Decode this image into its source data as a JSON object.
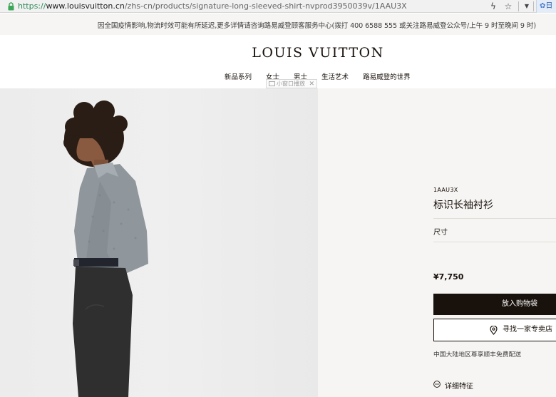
{
  "browser": {
    "url_scheme": "https://",
    "url_host": "www.louisvuitton.cn",
    "url_path": "/zhs-cn/products/signature-long-sleeved-shirt-nvprod3950039v/1AAU3X",
    "ext_tab_label": "日"
  },
  "notice": {
    "text": "因全国疫情影响,物流时效可能有所延迟,更多详情请咨询路易威登顾客服务中心(拨打 400 6588 555 或关注路易威登公众号/上午 9 时至晚间 9 时)"
  },
  "header": {
    "logo": "LOUIS VUITTON",
    "nav": [
      "新品系列",
      "女士",
      "男士",
      "生活艺术",
      "路易威登的世界"
    ],
    "mini_window_label": "小窗口播放",
    "mini_window_close": "✕"
  },
  "product": {
    "sku": "1AAU3X",
    "name": "标识长袖衬衫",
    "size_label": "尺寸",
    "price": "¥7,750",
    "add_to_bag": "放入购物袋",
    "find_store": "寻找一家专卖店",
    "delivery_note": "中国大陆地区尊享顺丰免费配送",
    "details_label": "详细特征"
  },
  "icons": {
    "lock": "lock-icon",
    "bolt": "bolt-icon",
    "star": "star-icon",
    "dropdown": "chevron-down-icon",
    "extension": "extension-icon",
    "pin": "location-pin-icon",
    "details": "more-dots-icon"
  },
  "colors": {
    "brand_dark": "#19110b",
    "panel_bg": "#f6f5f3",
    "secure_green": "#2e8b57"
  }
}
